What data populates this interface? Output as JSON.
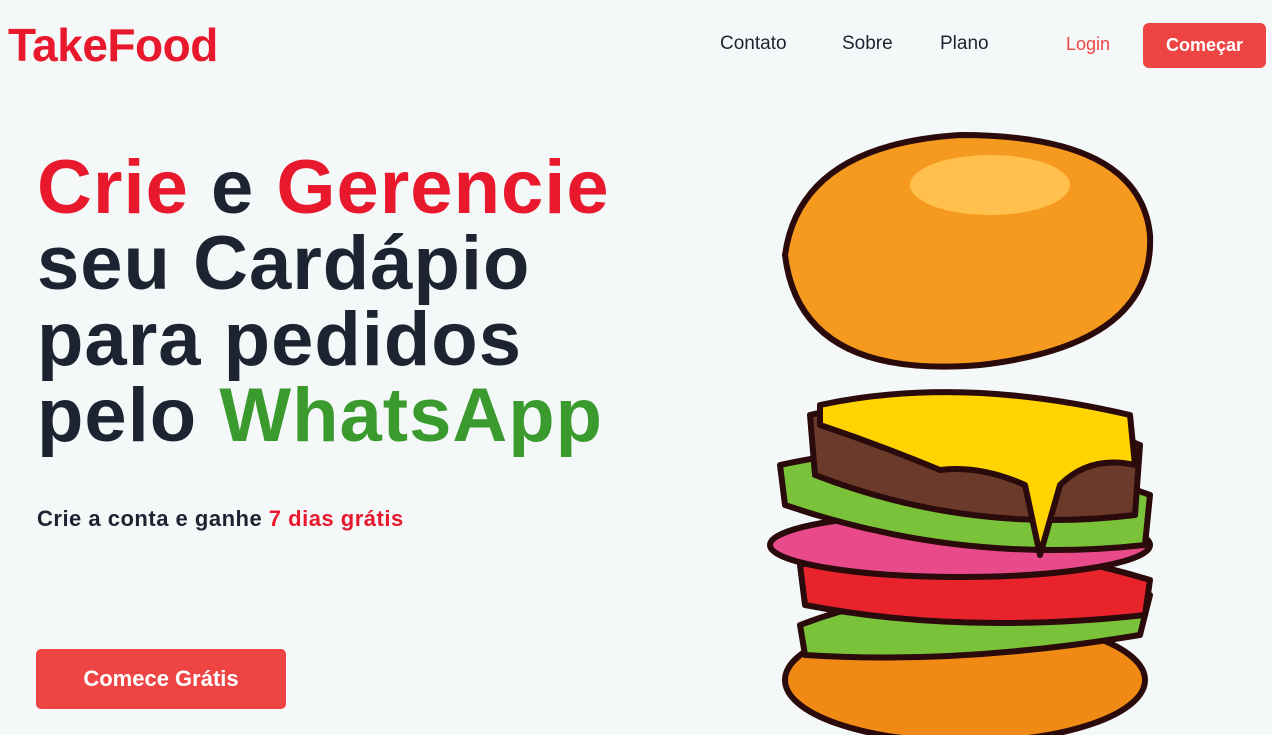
{
  "header": {
    "logo": "TakeFood",
    "nav": [
      {
        "label": "Contato"
      },
      {
        "label": "Sobre"
      },
      {
        "label": "Plano"
      }
    ],
    "login_label": "Login",
    "cta_label": "Começar"
  },
  "hero": {
    "word1": "Crie",
    "word2": " e ",
    "word3": "Gerencie",
    "line2": "seu Cardápio",
    "line3": "para pedidos",
    "line4_a": "pelo ",
    "line4_b": "WhatsApp"
  },
  "subtitle": {
    "text": "Crie a conta e ganhe ",
    "highlight": "7 dias grátis"
  },
  "start_button": "Comece Grátis",
  "illustration": {
    "icon": "burger-illustration"
  },
  "colors": {
    "accent": "#ef4444",
    "heading_red": "#e8192c",
    "whatsapp_green": "#3a9a2e",
    "text": "#1c2331",
    "background": "#f5f8f9"
  }
}
